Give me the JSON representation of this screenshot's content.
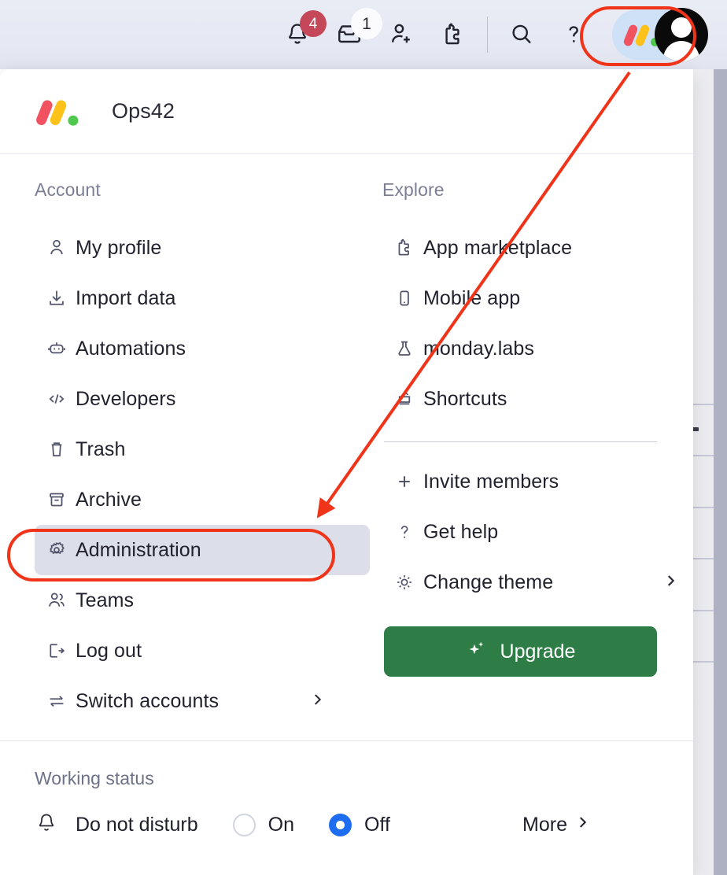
{
  "topbar": {
    "items": [
      {
        "name": "notifications",
        "icon": "bell-icon",
        "badge": "4",
        "badge_style": "red"
      },
      {
        "name": "inbox",
        "icon": "inbox-icon",
        "badge": "1",
        "badge_style": "white"
      },
      {
        "name": "invite",
        "icon": "user-plus-icon",
        "badge": null,
        "badge_style": null
      },
      {
        "name": "apps",
        "icon": "puzzle-icon",
        "badge": null,
        "badge_style": null
      },
      {
        "name": "search",
        "icon": "search-icon",
        "badge": null,
        "badge_style": null
      },
      {
        "name": "help",
        "icon": "question-mark-icon",
        "badge": null,
        "badge_style": null
      }
    ],
    "avatar_label": "monday-logo-avatar"
  },
  "menu": {
    "workspace_title": "Ops42",
    "account": {
      "section_title": "Account",
      "items": [
        {
          "label": "My profile",
          "icon": "person-icon",
          "selected": false,
          "chevron": false
        },
        {
          "label": "Import data",
          "icon": "download-icon",
          "selected": false,
          "chevron": false
        },
        {
          "label": "Automations",
          "icon": "robot-icon",
          "selected": false,
          "chevron": false
        },
        {
          "label": "Developers",
          "icon": "code-icon",
          "selected": false,
          "chevron": false
        },
        {
          "label": "Trash",
          "icon": "trash-icon",
          "selected": false,
          "chevron": false
        },
        {
          "label": "Archive",
          "icon": "archive-icon",
          "selected": false,
          "chevron": false
        },
        {
          "label": "Administration",
          "icon": "gear-icon",
          "selected": true,
          "chevron": false
        },
        {
          "label": "Teams",
          "icon": "people-icon",
          "selected": false,
          "chevron": false
        },
        {
          "label": "Log out",
          "icon": "logout-icon",
          "selected": false,
          "chevron": false
        },
        {
          "label": "Switch accounts",
          "icon": "switch-arrows-icon",
          "selected": false,
          "chevron": true
        }
      ]
    },
    "explore": {
      "section_title": "Explore",
      "items": [
        {
          "label": "App marketplace",
          "icon": "puzzle-icon",
          "chevron": false
        },
        {
          "label": "Mobile app",
          "icon": "mobile-icon",
          "chevron": false
        },
        {
          "label": "monday.labs",
          "icon": "flask-icon",
          "chevron": false
        },
        {
          "label": "Shortcuts",
          "icon": "keyboard-icon",
          "chevron": false
        }
      ],
      "items_secondary": [
        {
          "label": "Invite members",
          "icon": "plus-icon",
          "chevron": false
        },
        {
          "label": "Get help",
          "icon": "question-mark-icon",
          "chevron": false
        },
        {
          "label": "Change theme",
          "icon": "sun-icon",
          "chevron": true
        }
      ],
      "upgrade_label": "Upgrade",
      "upgrade_icon": "sparkle-icon"
    },
    "working_status": {
      "section_title": "Working status",
      "dnd_icon": "bell-icon",
      "dnd_label": "Do not disturb",
      "options": [
        {
          "label": "On",
          "selected": false
        },
        {
          "label": "Off",
          "selected": true
        }
      ],
      "more_label": "More",
      "more_icon": "chevron-right-icon"
    }
  },
  "annotations": {
    "highlight_color": "#f0341a",
    "avatar_box": "avatar-highlight",
    "admin_box": "administration-highlight",
    "arrow": "arrow-from-avatar-to-administration"
  },
  "colors": {
    "accent_blue": "#1e6cf0",
    "upgrade_green": "#2e7d46",
    "badge_red": "#c4485a",
    "selected_row": "#dcdee9",
    "logo_red": "#f0525f",
    "logo_yellow": "#fcc219",
    "logo_green": "#4ec94e"
  }
}
